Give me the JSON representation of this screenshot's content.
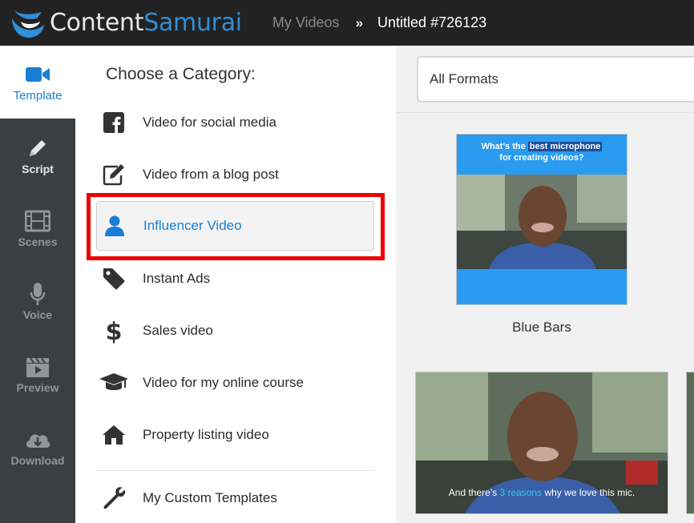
{
  "header": {
    "logo_part1": "Content",
    "logo_part2": "Samurai",
    "breadcrumb_link": "My Videos",
    "breadcrumb_sep": "»",
    "project_title": "Untitled #726123"
  },
  "nav": {
    "items": [
      {
        "label": "Template",
        "icon": "video-camera-icon",
        "active": true
      },
      {
        "label": "Script",
        "icon": "pencil-icon"
      },
      {
        "label": "Scenes",
        "icon": "film-icon"
      },
      {
        "label": "Voice",
        "icon": "microphone-icon"
      },
      {
        "label": "Preview",
        "icon": "clapperboard-icon"
      },
      {
        "label": "Download",
        "icon": "cloud-download-icon"
      }
    ]
  },
  "categories": {
    "title": "Choose a Category:",
    "items": [
      {
        "label": "Video for social media",
        "icon": "facebook-icon"
      },
      {
        "label": "Video from a blog post",
        "icon": "edit-icon"
      },
      {
        "label": "Influencer Video",
        "icon": "user-icon",
        "selected": true
      },
      {
        "label": "Instant Ads",
        "icon": "tag-icon"
      },
      {
        "label": "Sales video",
        "icon": "dollar-icon"
      },
      {
        "label": "Video for my online course",
        "icon": "graduation-cap-icon"
      },
      {
        "label": "Property listing video",
        "icon": "home-icon"
      },
      {
        "label": "My Custom Templates",
        "icon": "wrench-icon"
      }
    ]
  },
  "templates": {
    "format_filter": "All Formats",
    "cards": [
      {
        "name": "Blue Bars",
        "caption_pre": "What's the ",
        "caption_hl": "best microphone",
        "caption_post": "for creating videos?"
      },
      {
        "subtitle_pre": "And there's ",
        "subtitle_hl": "3 reasons",
        "subtitle_post": " why we love this mic."
      }
    ]
  },
  "colors": {
    "accent": "#1a7fd4",
    "highlight_border": "#ee0000",
    "nav_bg": "#3a3f44",
    "header_bg": "#222222",
    "bar_blue": "#2b9bf0"
  }
}
